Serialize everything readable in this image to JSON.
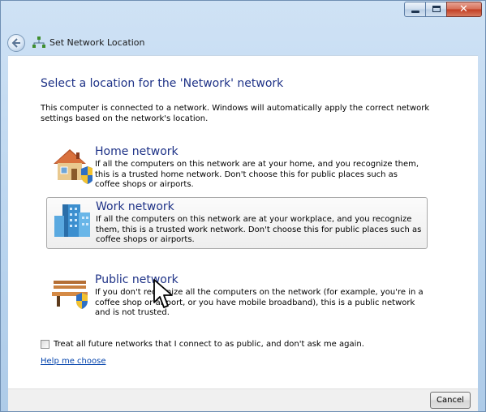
{
  "window": {
    "title": "Set Network Location"
  },
  "main": {
    "heading": "Select a location for the 'Network' network",
    "description": "This computer is connected to a network. Windows will automatically apply the correct network settings based on the network's location.",
    "options": [
      {
        "title": "Home network",
        "text": "If all the computers on this network are at your home, and you recognize them, this is a trusted home network.  Don't choose this for public places such as coffee shops or airports.",
        "icon": "home-icon"
      },
      {
        "title": "Work network",
        "text": "If all the computers on this network are at your workplace, and you recognize them, this is a trusted work network.  Don't choose this for public places such as coffee shops or airports.",
        "icon": "work-icon"
      },
      {
        "title": "Public network",
        "text": "If you don't recognize all the computers on the network (for example, you're in a coffee shop or airport, or you have mobile broadband), this is a public network and is not trusted.",
        "icon": "public-bench-icon"
      }
    ],
    "checkbox_label": "Treat all future networks that I connect to as public, and don't ask me again.",
    "checkbox_checked": false,
    "help_link": "Help me choose"
  },
  "footer": {
    "cancel_label": "Cancel"
  },
  "colors": {
    "heading": "#1e3287",
    "link": "#0645ad",
    "titlebar": "#b9d4ee"
  }
}
